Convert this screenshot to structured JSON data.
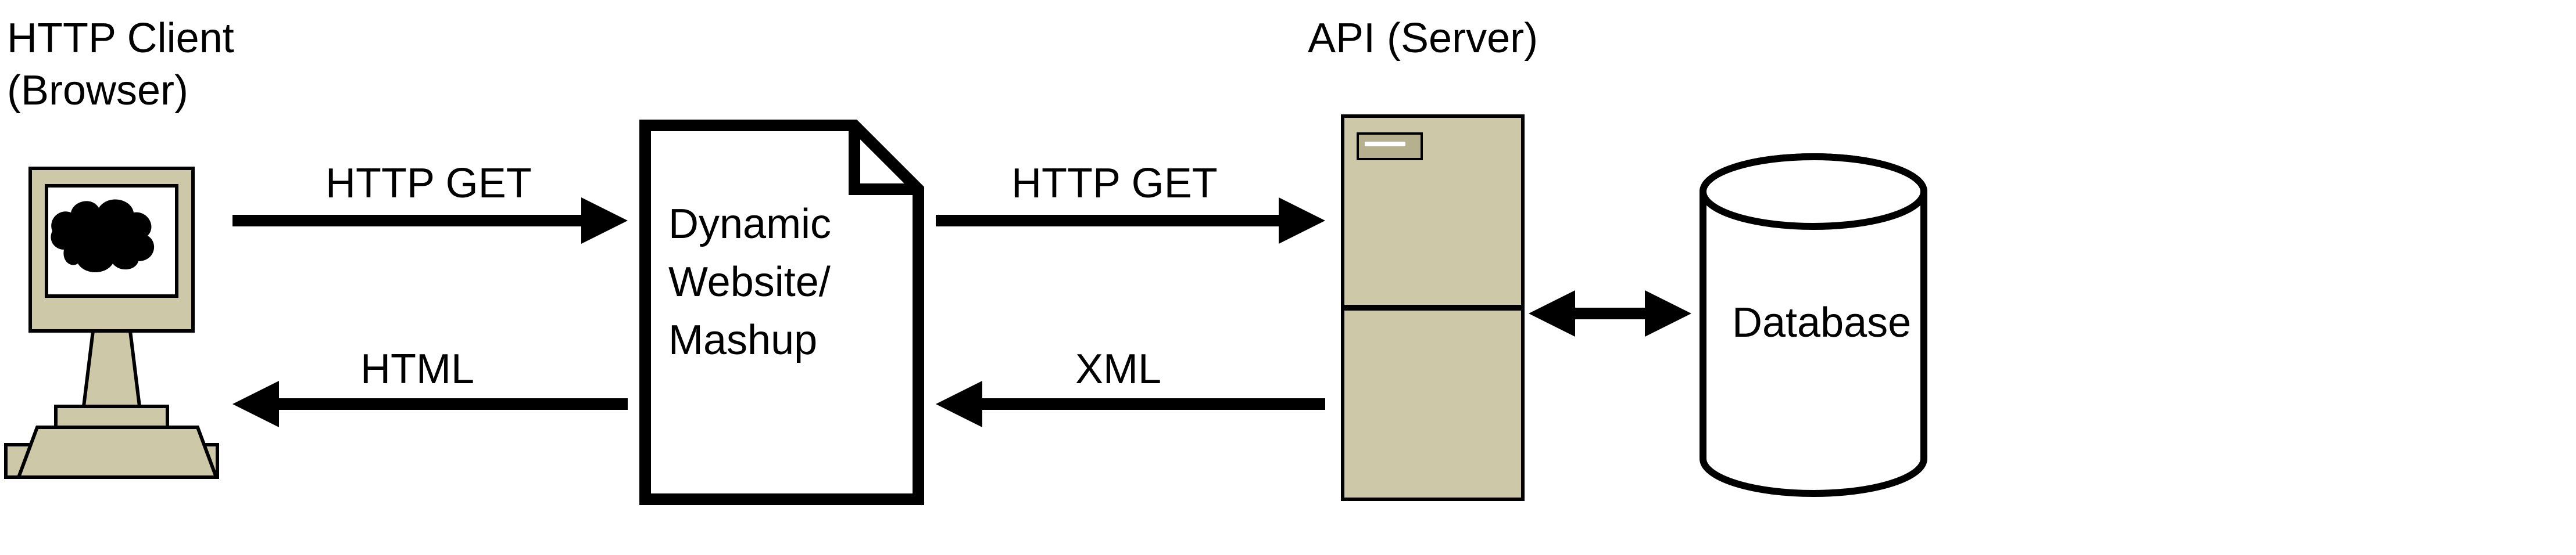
{
  "client": {
    "title_line1": "HTTP Client",
    "title_line2": "(Browser)"
  },
  "middle": {
    "line1": "Dynamic",
    "line2": "Website/",
    "line3": "Mashup"
  },
  "api": {
    "title": "API (Server)"
  },
  "db": {
    "label": "Database"
  },
  "arrows": {
    "client_to_mid": "HTTP GET",
    "mid_to_client": "HTML",
    "mid_to_api": "HTTP GET",
    "api_to_mid": "XML"
  }
}
